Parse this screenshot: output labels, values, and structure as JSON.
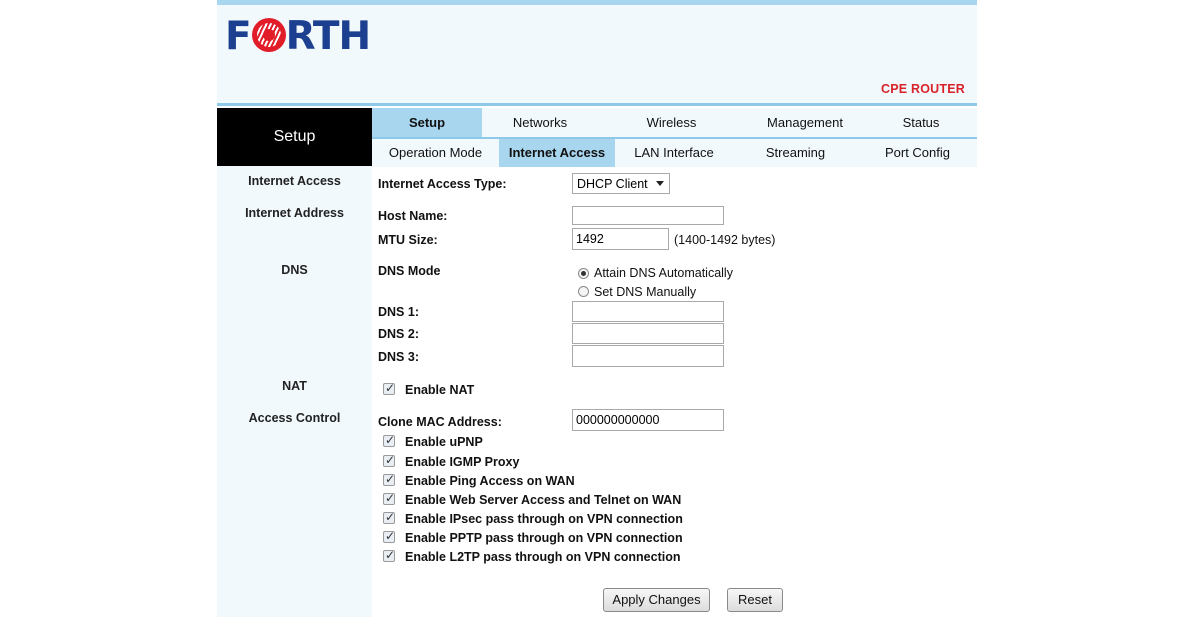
{
  "header": {
    "logo_text": "FORTH",
    "tagline": "CPE ROUTER"
  },
  "sidebar": {
    "title": "Setup",
    "sections": [
      "Internet Access",
      "Internet Address",
      "DNS",
      "NAT",
      "Access Control"
    ]
  },
  "nav": {
    "tabs": [
      "Setup",
      "Networks",
      "Wireless",
      "Management",
      "Status"
    ],
    "active_tab": "Setup",
    "subtabs": [
      "Operation Mode",
      "Internet Access",
      "LAN Interface",
      "Streaming",
      "Port Config"
    ],
    "active_subtab": "Internet Access"
  },
  "form": {
    "access_type_label": "Internet Access Type:",
    "access_type_value": "DHCP Client",
    "host_name_label": "Host Name:",
    "host_name_value": "",
    "mtu_label": "MTU Size:",
    "mtu_value": "1492",
    "mtu_hint": "(1400-1492 bytes)",
    "dns_mode_label": "DNS Mode",
    "dns_auto_label": "Attain DNS Automatically",
    "dns_manual_label": "Set DNS Manually",
    "dns_mode_selected": "auto",
    "dns1_label": "DNS 1:",
    "dns1_value": "",
    "dns2_label": "DNS 2:",
    "dns2_value": "",
    "dns3_label": "DNS 3:",
    "dns3_value": "",
    "nat_label": "Enable NAT",
    "nat_checked": true,
    "clone_mac_label": "Clone MAC Address:",
    "clone_mac_value": "000000000000",
    "options": [
      {
        "label": "Enable uPNP",
        "checked": true
      },
      {
        "label": "Enable IGMP Proxy",
        "checked": true
      },
      {
        "label": "Enable Ping Access on WAN",
        "checked": true
      },
      {
        "label": "Enable Web Server Access and Telnet on WAN",
        "checked": true
      },
      {
        "label": "Enable IPsec pass through on VPN connection",
        "checked": true
      },
      {
        "label": "Enable PPTP pass through on VPN connection",
        "checked": true
      },
      {
        "label": "Enable L2TP pass through on VPN connection",
        "checked": true
      }
    ]
  },
  "buttons": {
    "apply": "Apply Changes",
    "reset": "Reset"
  },
  "colors": {
    "accent": "#a8d6ee",
    "panel": "#f2f9fd",
    "brand_red": "#d8232a",
    "brand_blue": "#1d3f8f"
  }
}
